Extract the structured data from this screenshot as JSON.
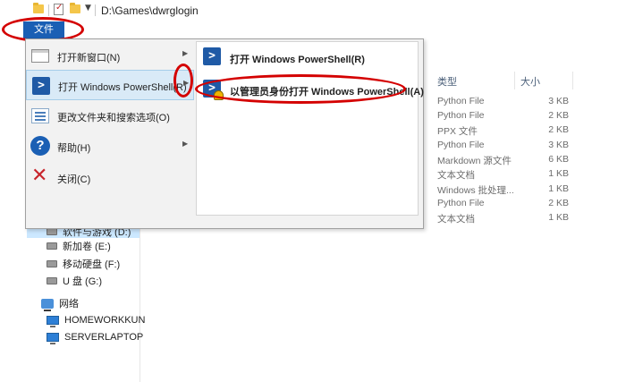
{
  "titlebar": {
    "path": "D:\\Games\\dwrglogin"
  },
  "ribbon": {
    "file_tab": "文件"
  },
  "file_menu": {
    "items": [
      {
        "label": "打开新窗口(N)",
        "icon": "new-window-icon",
        "has_submenu": true
      },
      {
        "label": "打开 Windows PowerShell(R)",
        "icon": "powershell-icon",
        "has_submenu": true,
        "active": true
      },
      {
        "label": "更改文件夹和搜索选项(O)",
        "icon": "folder-options-icon",
        "has_submenu": false
      },
      {
        "label": "帮助(H)",
        "icon": "help-icon",
        "has_submenu": true
      },
      {
        "label": "关闭(C)",
        "icon": "close-icon",
        "has_submenu": false
      }
    ],
    "submenu": [
      {
        "label": "打开 Windows PowerShell(R)",
        "icon": "powershell-icon"
      },
      {
        "label": "以管理员身份打开 Windows PowerShell(A)",
        "icon": "powershell-admin-icon"
      }
    ]
  },
  "columns": {
    "type": "类型",
    "size": "大小"
  },
  "files": [
    {
      "type": "Python File",
      "size": "3 KB"
    },
    {
      "type": "Python File",
      "size": "2 KB"
    },
    {
      "type": "PPX 文件",
      "size": "2 KB"
    },
    {
      "type": "Python File",
      "size": "3 KB"
    },
    {
      "type": "Markdown 源文件",
      "size": "6 KB"
    },
    {
      "type": "文本文档",
      "size": "1 KB"
    },
    {
      "type": "Windows 批处理...",
      "size": "1 KB"
    },
    {
      "type": "Python File",
      "size": "2 KB"
    },
    {
      "type": "文本文档",
      "size": "1 KB"
    }
  ],
  "nav": {
    "drives": [
      "软件与游戏 (D:)",
      "新加卷 (E:)",
      "移动硬盘 (F:)",
      "U 盘 (G:)"
    ],
    "network_label": "网络",
    "computers": [
      "HOMEWORKKUN",
      "SERVERLAPTOP"
    ]
  },
  "colors": {
    "accent": "#1a5fb4",
    "annotation": "#d40000"
  }
}
